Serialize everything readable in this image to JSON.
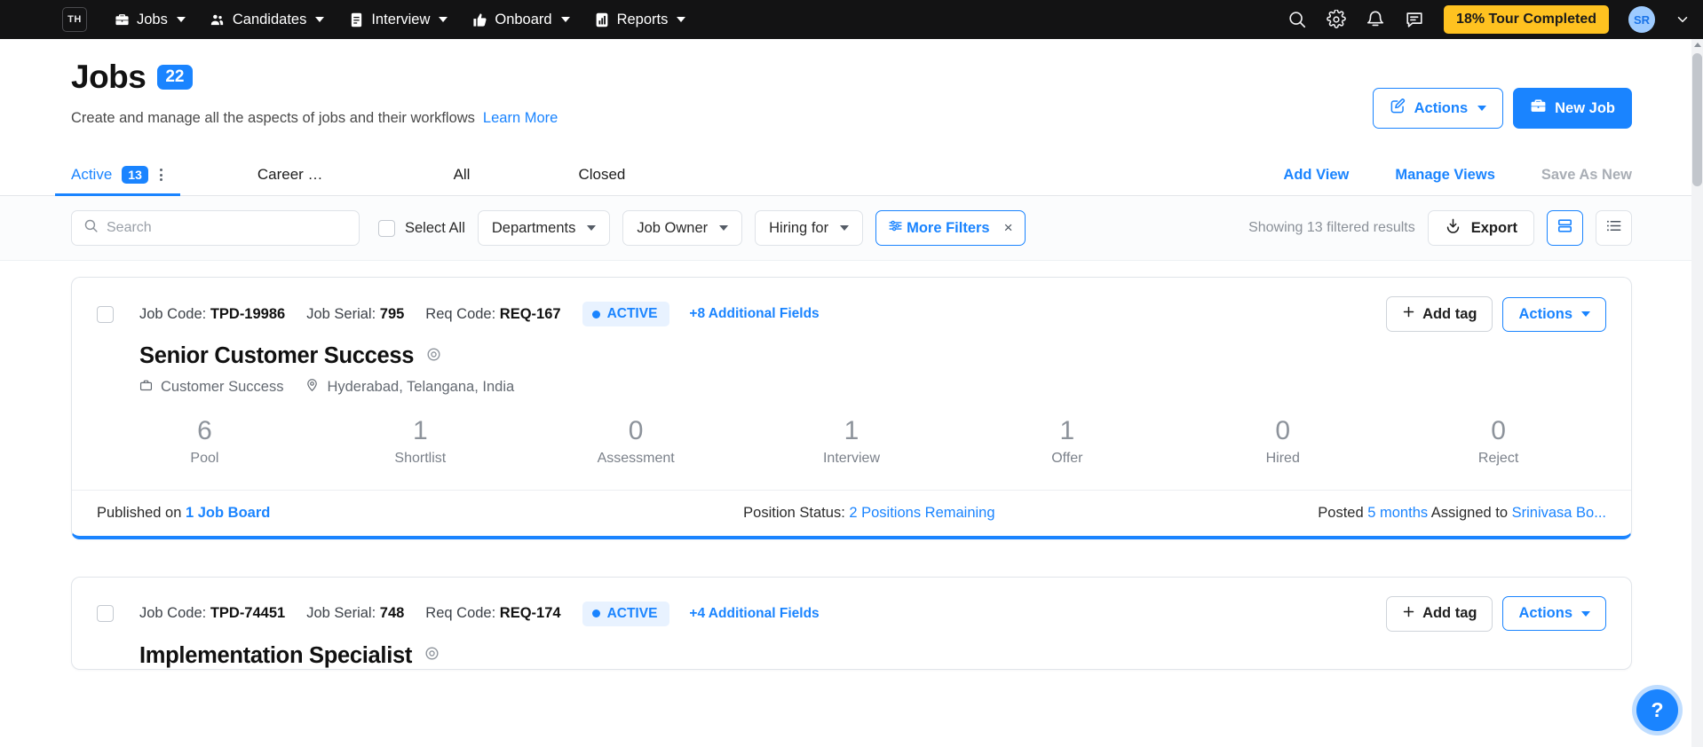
{
  "topnav": {
    "logo": "TH",
    "items": [
      {
        "label": "Jobs",
        "icon": "briefcase-icon"
      },
      {
        "label": "Candidates",
        "icon": "people-icon"
      },
      {
        "label": "Interview",
        "icon": "document-icon"
      },
      {
        "label": "Onboard",
        "icon": "thumbs-up-icon"
      },
      {
        "label": "Reports",
        "icon": "chart-icon"
      }
    ],
    "right_icons": [
      "search-icon",
      "gear-icon",
      "bell-icon",
      "chat-icon"
    ],
    "tour_badge": "18% Tour Completed",
    "avatar_initials": "SR"
  },
  "header": {
    "title": "Jobs",
    "count": "22",
    "subtitle": "Create and manage all the aspects of jobs and their workflows",
    "learn_more": "Learn More",
    "actions_label": "Actions",
    "new_job_label": "New Job"
  },
  "tabs": {
    "items": [
      {
        "label": "Active",
        "badge": "13",
        "active": true
      },
      {
        "label": "Career …",
        "badge": "",
        "active": false
      },
      {
        "label": "All",
        "badge": "",
        "active": false
      },
      {
        "label": "Closed",
        "badge": "",
        "active": false
      }
    ],
    "add_view": "Add View",
    "manage_views": "Manage Views",
    "save_as_new": "Save As New"
  },
  "filters": {
    "search_placeholder": "Search",
    "search_value": "",
    "select_all": "Select All",
    "departments": "Departments",
    "job_owner": "Job Owner",
    "hiring_for": "Hiring for",
    "more_filters": "More Filters",
    "more_filters_clear": "×",
    "showing": "Showing 13 filtered results",
    "export": "Export",
    "view_grid_icon": "grid-view-icon",
    "view_list_icon": "list-view-icon"
  },
  "jobs": [
    {
      "job_code_label": "Job Code:",
      "job_code": "TPD-19986",
      "job_serial_label": "Job Serial:",
      "job_serial": "795",
      "req_code_label": "Req Code:",
      "req_code": "REQ-167",
      "status": "ACTIVE",
      "additional_fields": "+8 Additional Fields",
      "add_tag": "Add tag",
      "actions": "Actions",
      "title": "Senior Customer Success",
      "department": "Customer Success",
      "location": "Hyderabad, Telangana, India",
      "stats": [
        {
          "num": "6",
          "label": "Pool"
        },
        {
          "num": "1",
          "label": "Shortlist"
        },
        {
          "num": "0",
          "label": "Assessment"
        },
        {
          "num": "1",
          "label": "Interview"
        },
        {
          "num": "1",
          "label": "Offer"
        },
        {
          "num": "0",
          "label": "Hired"
        },
        {
          "num": "0",
          "label": "Reject"
        }
      ],
      "published_prefix": "Published on ",
      "published_link": "1 Job Board",
      "position_status_label": "Position Status: ",
      "position_status_link": "2 Positions Remaining",
      "posted_prefix": "Posted ",
      "posted_link": "5 months",
      "assigned_prefix": " Assigned to ",
      "assigned_link": "Srinivasa Bo..."
    },
    {
      "job_code_label": "Job Code:",
      "job_code": "TPD-74451",
      "job_serial_label": "Job Serial:",
      "job_serial": "748",
      "req_code_label": "Req Code:",
      "req_code": "REQ-174",
      "status": "ACTIVE",
      "additional_fields": "+4 Additional Fields",
      "add_tag": "Add tag",
      "actions": "Actions",
      "title": "Implementation Specialist"
    }
  ],
  "help": {
    "label": "?"
  },
  "colors": {
    "accent_blue": "#1a84ff",
    "badge_yellow": "#FFC220",
    "nav_dark": "#131314"
  }
}
